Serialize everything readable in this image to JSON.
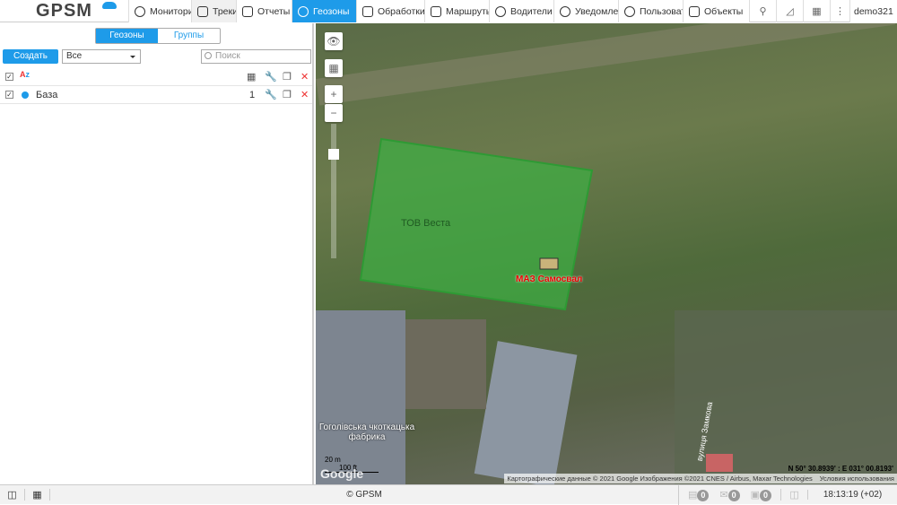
{
  "header": {
    "logo": "GPSM",
    "nav": [
      {
        "label": "Мониторинг",
        "icon": "globe-icon"
      },
      {
        "label": "Треки",
        "icon": "flag-icon"
      },
      {
        "label": "Отчеты",
        "icon": "report-icon"
      },
      {
        "label": "Геозоны",
        "icon": "geozone-icon",
        "active": true
      },
      {
        "label": "Обработки",
        "icon": "processing-icon"
      },
      {
        "label": "Маршруты",
        "icon": "route-icon"
      },
      {
        "label": "Водители",
        "icon": "driver-icon"
      },
      {
        "label": "Уведомления",
        "icon": "alarm-icon"
      },
      {
        "label": "Пользователи",
        "icon": "user-icon"
      },
      {
        "label": "Объекты",
        "icon": "bus-icon"
      }
    ],
    "user": "demo321"
  },
  "panel": {
    "tabs": [
      "Геозоны",
      "Группы"
    ],
    "create_label": "Создать",
    "filter_value": "Все",
    "search_placeholder": "Поиск",
    "rows": [
      {
        "name": "База",
        "count": "1",
        "color": "#1e9be9"
      }
    ]
  },
  "map": {
    "geozone_label": "ТОВ Веста",
    "vehicle_label": "МАЗ Самосвал",
    "place_label": "Гоголівська чкоткацька фабрика",
    "street_label": "вулиця Замкова",
    "scale_m": "20 m",
    "scale_ft": "100 ft",
    "google": "Google",
    "coords": "N 50° 30.8939' : E 031° 00.8193'",
    "attribution": "Картографические данные © 2021 Google Изображения ©2021 CNES / Airbus, Maxar Technologies",
    "terms": "Условия использования",
    "geozone_color": "#3cb043"
  },
  "footer": {
    "copyright": "© GPSM",
    "counts": [
      "0",
      "0",
      "0"
    ],
    "time": "18:13:19 (+02)"
  }
}
